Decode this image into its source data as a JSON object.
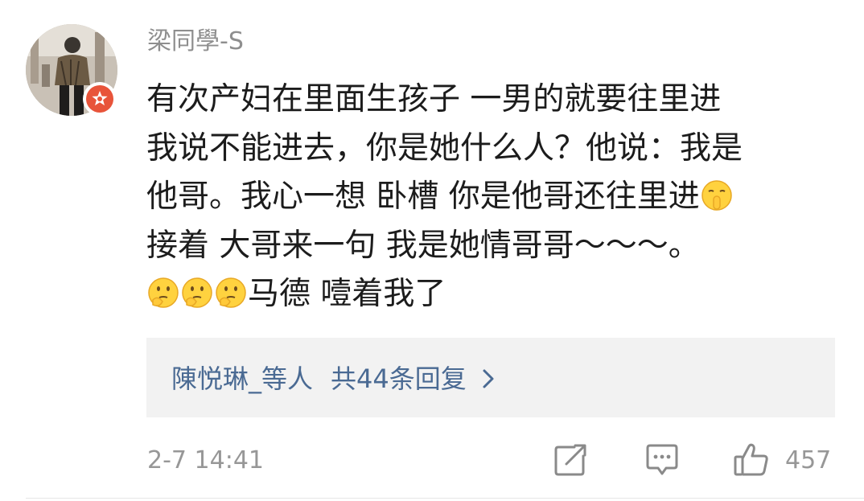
{
  "user": {
    "name": "梁同學-S",
    "avatar_icon": "user-avatar-photo",
    "badge_icon": "verified-star-badge-icon",
    "badge_color": "#e8543a"
  },
  "comment": {
    "lines": [
      "有次产妇在里面生孩子 一男的就要往里进",
      "我说不能进去，你是她什么人？他说：我是",
      "他哥。我心一想 卧槽 你是他哥还往里进",
      "接着 大哥来一句 我是她情哥哥～～～。",
      "马德 噎着我了"
    ],
    "emoji_hush_icon": "hush-face-emoji-icon",
    "emoji_think_icon": "thinking-face-emoji-icon"
  },
  "replies": {
    "who": "陳悦琳_等人",
    "count_text": "共44条回复",
    "link_color": "#4a6a93",
    "chevron_icon": "chevron-right-icon"
  },
  "footer": {
    "time": "2-7 14:41",
    "share_icon": "share-icon",
    "comment_icon": "comment-icon",
    "like_icon": "thumbs-up-icon",
    "like_count": "457"
  }
}
